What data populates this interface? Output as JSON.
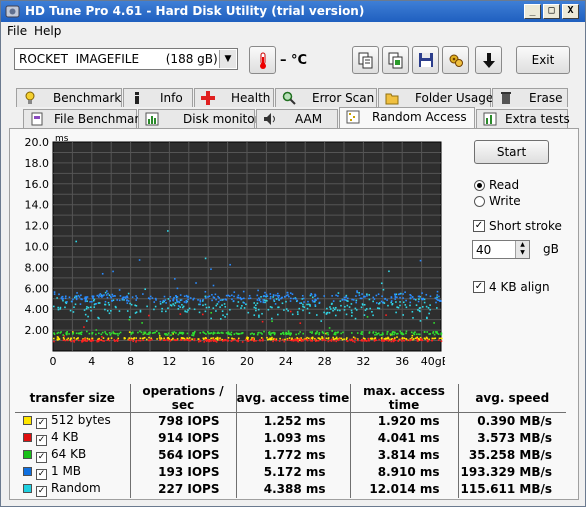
{
  "window": {
    "title": "HD Tune Pro 4.61 - Hard Disk Utility (trial version)",
    "controls": [
      "_",
      "□",
      "X"
    ]
  },
  "menu": [
    "File",
    "Help"
  ],
  "toolbar": {
    "drive": "ROCKET  IMAGEFILE       (188 gB)",
    "temperature": "– °C",
    "exit_label": "Exit",
    "icons": [
      "thermometer-icon",
      "copy-icon",
      "copy-screen-icon",
      "save-icon",
      "options-icon",
      "download-icon"
    ]
  },
  "tabs_top": [
    "Benchmark",
    "Info",
    "Health",
    "Error Scan",
    "Folder Usage",
    "Erase"
  ],
  "tabs_bottom": [
    "File Benchmark",
    "Disk monitor",
    "AAM",
    "Random Access",
    "Extra tests"
  ],
  "active_tab": "Random Access",
  "side": {
    "start_label": "Start",
    "read_label": "Read",
    "write_label": "Write",
    "short_stroke_label": "Short stroke",
    "short_stroke_value": "40",
    "short_stroke_unit": "gB",
    "align_label": "4 KB align",
    "mode_selected": "Read",
    "short_stroke_checked": true,
    "align_checked": true
  },
  "chart_data": {
    "type": "scatter",
    "ylabel": "ms",
    "xlabel": "40gB",
    "x_ticks": [
      "0",
      "4",
      "8",
      "12",
      "16",
      "20",
      "24",
      "28",
      "32",
      "36",
      "40gB"
    ],
    "y_ticks": [
      "20.0",
      "18.0",
      "16.0",
      "14.0",
      "12.0",
      "10.0",
      "8.00",
      "6.00",
      "4.00",
      "2.00"
    ],
    "xlim": [
      0,
      40
    ],
    "ylim": [
      0,
      20
    ],
    "grid": true,
    "background": "#2e2e2e",
    "series": [
      {
        "name": "512 bytes",
        "color": "#ffe600",
        "mean": 1.252,
        "max": 1.92
      },
      {
        "name": "4 KB",
        "color": "#ff2020",
        "mean": 1.093,
        "max": 4.041
      },
      {
        "name": "64 KB",
        "color": "#30e030",
        "mean": 1.772,
        "max": 3.814
      },
      {
        "name": "1 MB",
        "color": "#2a8cff",
        "mean": 5.172,
        "max": 8.91
      },
      {
        "name": "Random",
        "color": "#30d8e8",
        "mean": 4.388,
        "max": 12.014
      }
    ]
  },
  "results": {
    "headers": [
      "transfer size",
      "operations / sec",
      "avg. access time",
      "max. access time",
      "avg. speed"
    ],
    "rows": [
      {
        "size": "512 bytes",
        "color": "#ffe600",
        "ops": "798 IOPS",
        "avg": "1.252 ms",
        "max": "1.920 ms",
        "speed": "0.390 MB/s"
      },
      {
        "size": "4 KB",
        "color": "#e01010",
        "ops": "914 IOPS",
        "avg": "1.093 ms",
        "max": "4.041 ms",
        "speed": "3.573 MB/s"
      },
      {
        "size": "64 KB",
        "color": "#18c018",
        "ops": "564 IOPS",
        "avg": "1.772 ms",
        "max": "3.814 ms",
        "speed": "35.258 MB/s"
      },
      {
        "size": "1 MB",
        "color": "#1070e0",
        "ops": "193 IOPS",
        "avg": "5.172 ms",
        "max": "8.910 ms",
        "speed": "193.329 MB/s"
      },
      {
        "size": "Random",
        "color": "#20d0e0",
        "ops": "227 IOPS",
        "avg": "4.388 ms",
        "max": "12.014 ms",
        "speed": "115.611 MB/s"
      }
    ]
  }
}
